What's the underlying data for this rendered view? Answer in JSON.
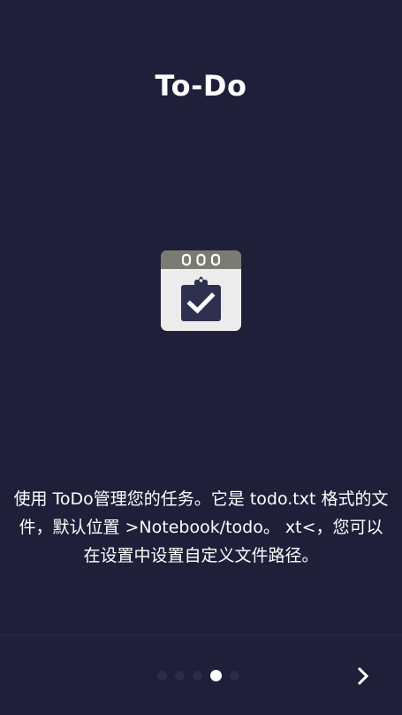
{
  "app": {
    "title": "To-Do"
  },
  "onboarding": {
    "hero_icon": "calendar-clipboard-check-icon",
    "description": "使用 ToDo管理您的任务。它是 todo.txt 格式的文件，默认位置 >Notebook/todo。 xt<，您可以在设置中设置自定义文件路径。",
    "page_count": 5,
    "current_page": 4
  },
  "navigation": {
    "next_icon": "chevron-right-icon"
  },
  "colors": {
    "background": "#1f1f3a",
    "text": "#ffffff",
    "dot_inactive": "#2b2b48",
    "dot_active": "#ffffff",
    "calendar_header": "#7b7b72",
    "calendar_body": "#ececec",
    "clipboard": "#2f2f4f"
  }
}
